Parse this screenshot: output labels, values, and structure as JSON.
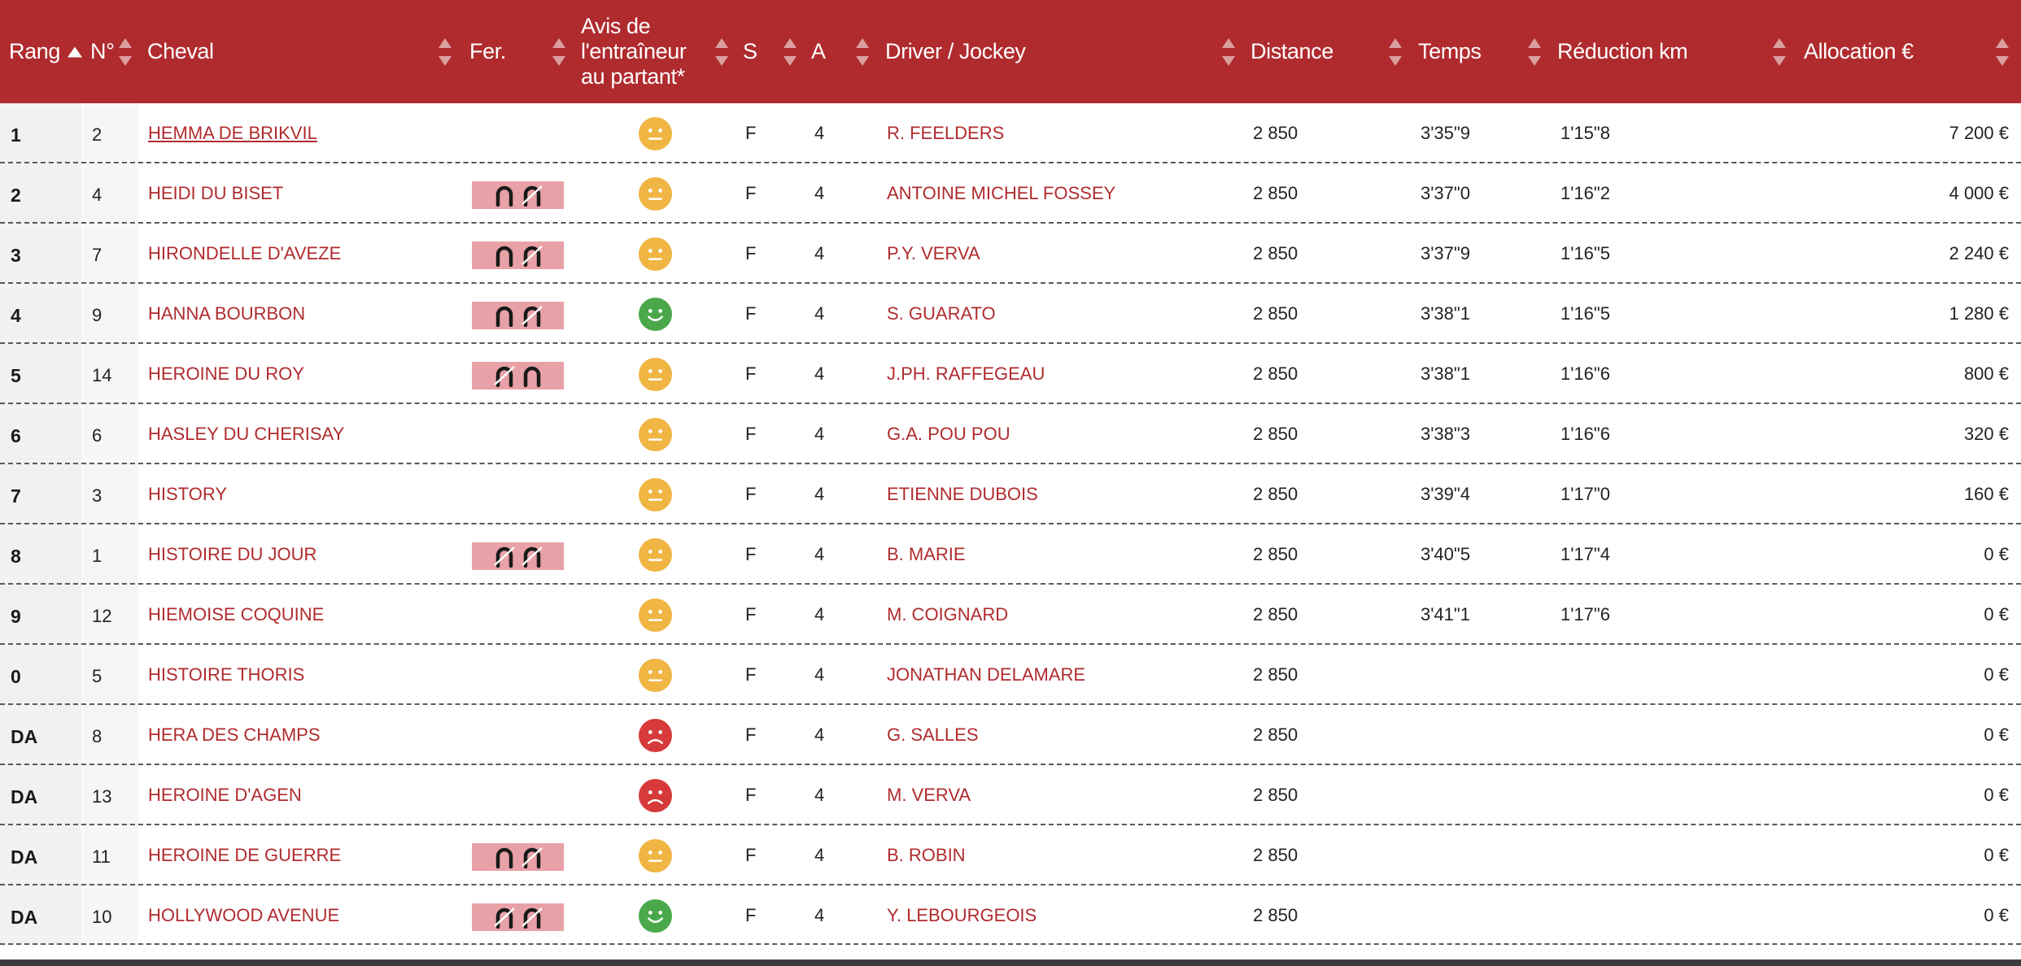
{
  "header": {
    "rang": "Rang",
    "num": "N°",
    "cheval": "Cheval",
    "fer": "Fer.",
    "avis": "Avis de l'entraîneur au partant*",
    "sexe": "S",
    "age": "A",
    "driver": "Driver / Jockey",
    "distance": "Distance",
    "temps": "Temps",
    "reduction": "Réduction km",
    "allocation": "Allocation €"
  },
  "colors": {
    "header_bg": "#b02b2e",
    "link": "#b02b2e",
    "shoe_badge": "#e8a1a6",
    "mood_neutral": "#f0b543",
    "mood_positive": "#4aa84a",
    "mood_negative": "#d63a3a"
  },
  "rows": [
    {
      "rang": "1",
      "num": "2",
      "cheval": "HEMMA DE BRIKVIL",
      "fer": null,
      "avis": "neutral",
      "sexe": "F",
      "age": "4",
      "driver": "R. FEELDERS",
      "distance": "2 850",
      "temps": "3'35\"9",
      "reduction": "1'15\"8",
      "allocation": "7 200 €"
    },
    {
      "rang": "2",
      "num": "4",
      "cheval": "HEIDI DU BISET",
      "fer": "D4",
      "avis": "neutral",
      "sexe": "F",
      "age": "4",
      "driver": "ANTOINE MICHEL FOSSEY",
      "distance": "2 850",
      "temps": "3'37\"0",
      "reduction": "1'16\"2",
      "allocation": "4 000 €"
    },
    {
      "rang": "3",
      "num": "7",
      "cheval": "HIRONDELLE D'AVEZE",
      "fer": "D4",
      "avis": "neutral",
      "sexe": "F",
      "age": "4",
      "driver": "P.Y. VERVA",
      "distance": "2 850",
      "temps": "3'37\"9",
      "reduction": "1'16\"5",
      "allocation": "2 240 €"
    },
    {
      "rang": "4",
      "num": "9",
      "cheval": "HANNA BOURBON",
      "fer": "D4",
      "avis": "positive",
      "sexe": "F",
      "age": "4",
      "driver": "S. GUARATO",
      "distance": "2 850",
      "temps": "3'38\"1",
      "reduction": "1'16\"5",
      "allocation": "1 280 €"
    },
    {
      "rang": "5",
      "num": "14",
      "cheval": "HEROINE DU ROY",
      "fer": "DA",
      "avis": "neutral",
      "sexe": "F",
      "age": "4",
      "driver": "J.PH. RAFFEGEAU",
      "distance": "2 850",
      "temps": "3'38\"1",
      "reduction": "1'16\"6",
      "allocation": "800 €"
    },
    {
      "rang": "6",
      "num": "6",
      "cheval": "HASLEY DU CHERISAY",
      "fer": null,
      "avis": "neutral",
      "sexe": "F",
      "age": "4",
      "driver": "G.A. POU POU",
      "distance": "2 850",
      "temps": "3'38\"3",
      "reduction": "1'16\"6",
      "allocation": "320 €"
    },
    {
      "rang": "7",
      "num": "3",
      "cheval": "HISTORY",
      "fer": null,
      "avis": "neutral",
      "sexe": "F",
      "age": "4",
      "driver": "ETIENNE DUBOIS",
      "distance": "2 850",
      "temps": "3'39\"4",
      "reduction": "1'17\"0",
      "allocation": "160 €"
    },
    {
      "rang": "8",
      "num": "1",
      "cheval": "HISTOIRE DU JOUR",
      "fer": "D44",
      "avis": "neutral",
      "sexe": "F",
      "age": "4",
      "driver": "B. MARIE",
      "distance": "2 850",
      "temps": "3'40\"5",
      "reduction": "1'17\"4",
      "allocation": "0 €"
    },
    {
      "rang": "9",
      "num": "12",
      "cheval": "HIEMOISE COQUINE",
      "fer": null,
      "avis": "neutral",
      "sexe": "F",
      "age": "4",
      "driver": "M. COIGNARD",
      "distance": "2 850",
      "temps": "3'41\"1",
      "reduction": "1'17\"6",
      "allocation": "0 €"
    },
    {
      "rang": "0",
      "num": "5",
      "cheval": "HISTOIRE THORIS",
      "fer": null,
      "avis": "neutral",
      "sexe": "F",
      "age": "4",
      "driver": "JONATHAN DELAMARE",
      "distance": "2 850",
      "temps": "",
      "reduction": "",
      "allocation": "0 €"
    },
    {
      "rang": "DA",
      "num": "8",
      "cheval": "HERA DES CHAMPS",
      "fer": null,
      "avis": "negative",
      "sexe": "F",
      "age": "4",
      "driver": "G. SALLES",
      "distance": "2 850",
      "temps": "",
      "reduction": "",
      "allocation": "0 €"
    },
    {
      "rang": "DA",
      "num": "13",
      "cheval": "HEROINE D'AGEN",
      "fer": null,
      "avis": "negative",
      "sexe": "F",
      "age": "4",
      "driver": "M. VERVA",
      "distance": "2 850",
      "temps": "",
      "reduction": "",
      "allocation": "0 €"
    },
    {
      "rang": "DA",
      "num": "11",
      "cheval": "HEROINE DE GUERRE",
      "fer": "D4",
      "avis": "neutral",
      "sexe": "F",
      "age": "4",
      "driver": "B. ROBIN",
      "distance": "2 850",
      "temps": "",
      "reduction": "",
      "allocation": "0 €"
    },
    {
      "rang": "DA",
      "num": "10",
      "cheval": "HOLLYWOOD AVENUE",
      "fer": "D44",
      "avis": "positive",
      "sexe": "F",
      "age": "4",
      "driver": "Y. LEBOURGEOIS",
      "distance": "2 850",
      "temps": "",
      "reduction": "",
      "allocation": "0 €"
    }
  ]
}
